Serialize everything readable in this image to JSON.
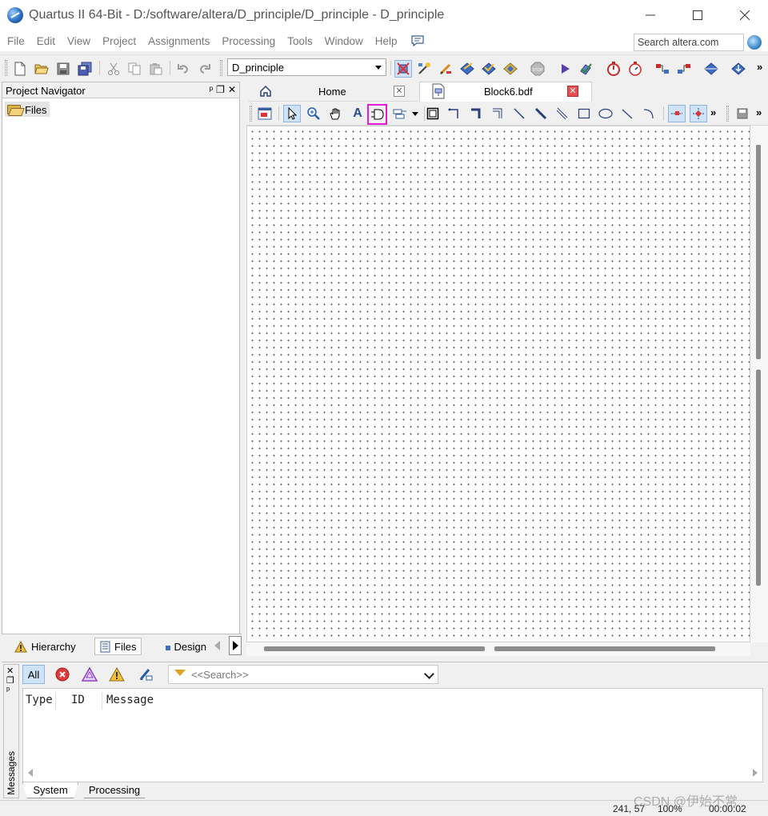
{
  "window": {
    "title": "Quartus II 64-Bit - D:/software/altera/D_principle/D_principle - D_principle"
  },
  "menu": {
    "items": [
      "File",
      "Edit",
      "View",
      "Project",
      "Assignments",
      "Processing",
      "Tools",
      "Window",
      "Help"
    ]
  },
  "search": {
    "placeholder": "Search altera.com"
  },
  "toolbar": {
    "project_combo": "D_principle"
  },
  "navigator": {
    "title": "Project Navigator",
    "files_item": "Files",
    "tabs": [
      "Hierarchy",
      "Files",
      "Design"
    ]
  },
  "doc_tabs": {
    "home": "Home",
    "block": "Block6.bdf"
  },
  "messages": {
    "panel_label": "Messages",
    "filter_all": "All",
    "search_placeholder": "<<Search>>",
    "columns": [
      "Type",
      "ID",
      "Message"
    ],
    "tabs": [
      "System",
      "Processing"
    ]
  },
  "status": {
    "coords": "241, 57",
    "zoom": "100%",
    "elapsed": "00:00:02"
  },
  "watermark": "CSDN @伊始不常",
  "colors": {
    "highlight_box": "#e61ad8",
    "close_red": "#e65050",
    "pressed_blue": "#cfe3f7"
  }
}
